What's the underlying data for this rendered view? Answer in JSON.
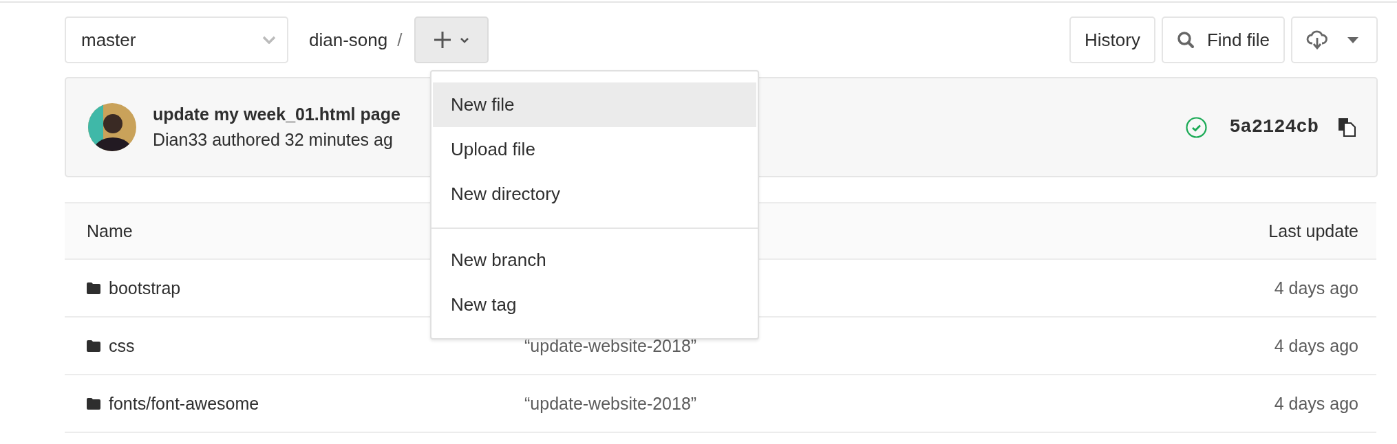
{
  "toolbar": {
    "branch": "master",
    "path": "dian-song",
    "separator": "/",
    "add_menu": {
      "expanded": true,
      "sections": [
        {
          "items": [
            {
              "label": "New file",
              "selected": true
            },
            {
              "label": "Upload file",
              "selected": false
            },
            {
              "label": "New directory",
              "selected": false
            }
          ]
        },
        {
          "items": [
            {
              "label": "New branch",
              "selected": false
            },
            {
              "label": "New tag",
              "selected": false
            }
          ]
        }
      ]
    },
    "actions": [
      {
        "kind": "history",
        "label": "History"
      },
      {
        "kind": "search",
        "label": "Find file"
      },
      {
        "kind": "download"
      }
    ]
  },
  "commit": {
    "title": "update my week_01.html page",
    "meta": "Dian33 authored 32 minutes ag",
    "pipeline_passed": true,
    "sha": "5a2124cb"
  },
  "table": {
    "columns": {
      "name": "Name",
      "last_update": "Last update"
    },
    "rows": [
      {
        "kind": "folder",
        "name": "bootstrap",
        "last_update": "4 days ago"
      },
      {
        "kind": "folder",
        "name": "css",
        "commit": "“update-website-2018”",
        "last_update": "4 days ago"
      },
      {
        "kind": "folder",
        "name": "fonts/font-awesome",
        "commit": "“update-website-2018”",
        "last_update": "4 days ago"
      }
    ]
  }
}
